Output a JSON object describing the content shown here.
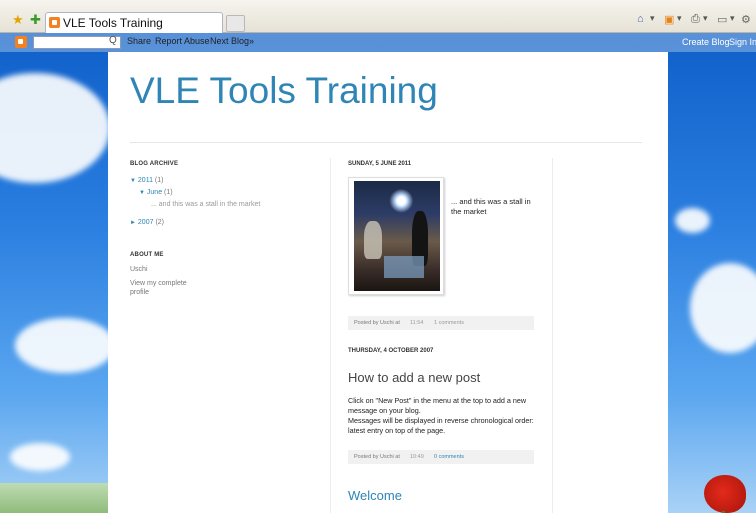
{
  "browser": {
    "tab_title": "VLE Tools Training",
    "toolbar_icons": [
      "home-icon",
      "feed-icon",
      "print-icon",
      "page-icon",
      "tools-icon"
    ]
  },
  "navbar": {
    "search_button": "Q",
    "links": [
      "Share",
      "Report Abuse",
      "Next Blog»"
    ],
    "right_links": [
      "Create Blog",
      "Sign In"
    ]
  },
  "blog": {
    "title": "VLE Tools Training"
  },
  "sidebar": {
    "archive_heading": "BLOG ARCHIVE",
    "year_2011": "2011",
    "year_2011_count": "(1)",
    "month_june": "June",
    "month_june_count": "(1)",
    "post_june": "... and this was a stall in the market",
    "year_2007": "2007",
    "year_2007_count": "(2)",
    "about_heading": "ABOUT ME",
    "author": "Uschi",
    "profile_link": "View my complete profile"
  },
  "posts": [
    {
      "date": "SUNDAY, 5 JUNE 2011",
      "caption": "... and this was a stall in the market",
      "footer_posted": "Posted by Uschi at",
      "footer_time": "11:54",
      "footer_comments": "1 comments"
    },
    {
      "date": "THURSDAY, 4 OCTOBER 2007",
      "title": "How to add a new post",
      "body": "Click on \"New Post\" in the menu at the top to add a new message on your blog.\nMessages will be displayed in reverse chronological order: latest entry on top of the page.",
      "footer_posted": "Posted by Uschi at",
      "footer_time": "10:49",
      "footer_comments": "0 comments"
    },
    {
      "title": "Welcome"
    }
  ]
}
